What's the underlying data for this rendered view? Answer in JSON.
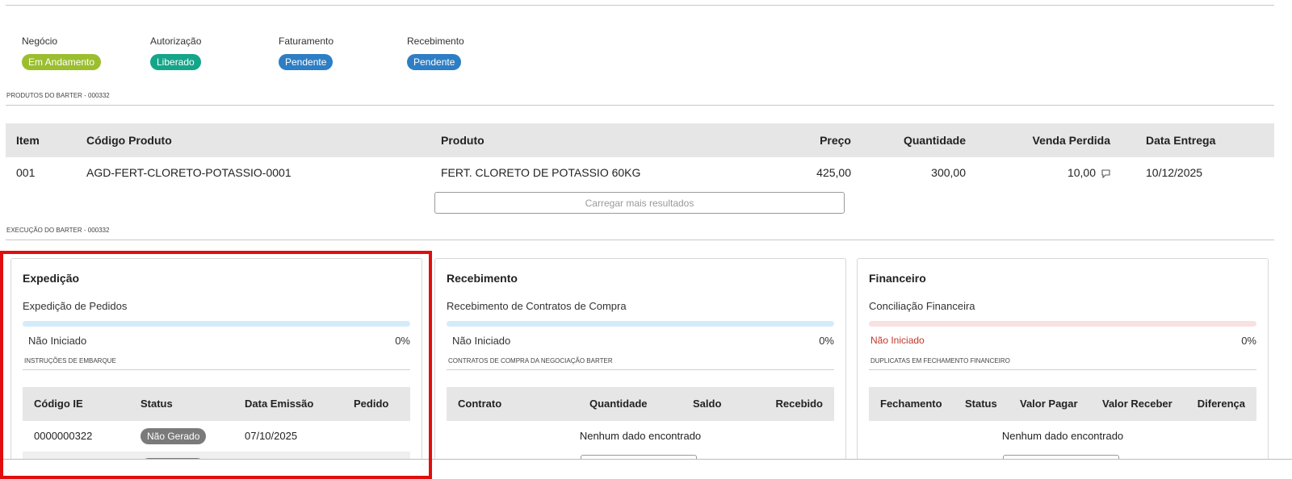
{
  "statuses": [
    {
      "label": "Negócio",
      "value": "Em Andamento",
      "color": "#9bbe2f"
    },
    {
      "label": "Autorização",
      "value": "Liberado",
      "color": "#14a58a"
    },
    {
      "label": "Faturamento",
      "value": "Pendente",
      "color": "#2d7ec4"
    },
    {
      "label": "Recebimento",
      "value": "Pendente",
      "color": "#2d7ec4"
    }
  ],
  "products_section": "PRODUTOS DO BARTER - 000332",
  "products_table": {
    "headers": [
      "Item",
      "Código Produto",
      "Produto",
      "Preço",
      "Quantidade",
      "Venda Perdida",
      "Data Entrega"
    ],
    "rows": [
      {
        "item": "001",
        "codigo": "AGD-FERT-CLORETO-POTASSIO-0001",
        "produto": "FERT. CLORETO DE POTASSIO 60KG",
        "preco": "425,00",
        "quantidade": "300,00",
        "venda_perdida": "10,00",
        "data_entrega": "10/12/2025"
      }
    ],
    "load_more": "Carregar mais resultados"
  },
  "execution_section": "EXECUÇÃO DO BARTER - 000332",
  "cards": {
    "expedicao": {
      "title": "Expedição",
      "subtitle": "Expedição de Pedidos",
      "progress_status": "Não Iniciado",
      "progress_pct": "0%",
      "progress_color": "#d4ecfa",
      "section": "INSTRUÇÕES DE EMBARQUE",
      "headers": [
        "Código IE",
        "Status",
        "Data Emissão",
        "Pedido"
      ],
      "rows": [
        {
          "codigo": "0000000322",
          "status": "Não Gerado",
          "data": "07/10/2025",
          "pedido": ""
        }
      ]
    },
    "recebimento": {
      "title": "Recebimento",
      "subtitle": "Recebimento de Contratos de Compra",
      "progress_status": "Não Iniciado",
      "progress_pct": "0%",
      "progress_color": "#d4ecfa",
      "section": "CONTRATOS DE COMPRA DA NEGOCIAÇÃO BARTER",
      "headers": [
        "Contrato",
        "Quantidade",
        "Saldo",
        "Recebido"
      ],
      "empty": "Nenhum dado encontrado"
    },
    "financeiro": {
      "title": "Financeiro",
      "subtitle": "Conciliação Financeira",
      "progress_status": "Não Iniciado",
      "progress_pct": "0%",
      "progress_color": "#f8e1e1",
      "status_color": "#c0392b",
      "section": "DUPLICATAS EM FECHAMENTO FINANCEIRO",
      "headers": [
        "Fechamento",
        "Status",
        "Valor Pagar",
        "Valor Receber",
        "Diferença"
      ],
      "empty": "Nenhum dado encontrado"
    }
  },
  "highlight_color": "#e00e0e"
}
